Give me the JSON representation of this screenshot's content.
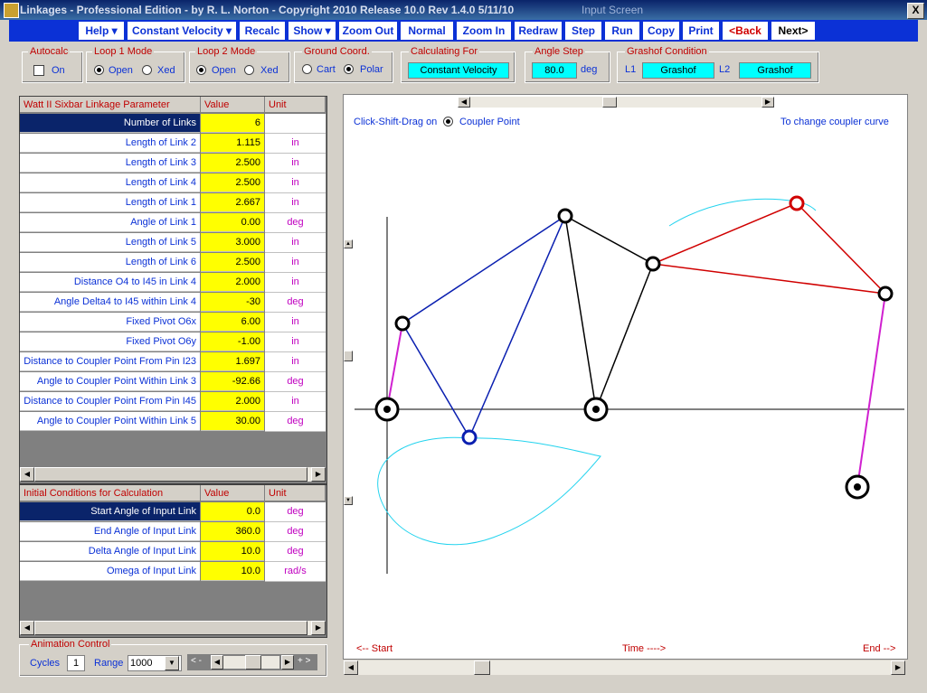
{
  "window": {
    "title": "Linkages - Professional Edition - by R. L. Norton - Copyright 2010   Release 10.0   Rev 1.4.0   5/11/10",
    "screen_name": "Input Screen",
    "close_glyph": "X"
  },
  "toolbar": {
    "items": [
      "Help ▾",
      "Constant Velocity ▾",
      "Recalc",
      "Show ▾",
      "Zoom Out",
      "Normal",
      "Zoom In",
      "Redraw",
      "Step",
      "Run",
      "Copy",
      "Print",
      "<Back",
      "Next>"
    ]
  },
  "settings": {
    "autocalc": {
      "title": "Autocalc",
      "option": "On"
    },
    "loop1": {
      "title": "Loop 1 Mode",
      "options": [
        "Open",
        "Xed"
      ]
    },
    "loop2": {
      "title": "Loop 2 Mode",
      "options": [
        "Open",
        "Xed"
      ]
    },
    "ground": {
      "title": "Ground Coord.",
      "options": [
        "Cart",
        "Polar"
      ]
    },
    "calculating": {
      "title": "Calculating For",
      "value": "Constant Velocity"
    },
    "angle_step": {
      "title": "Angle Step",
      "value": "80.0",
      "unit": "deg"
    },
    "grashof": {
      "title": "Grashof Condition",
      "l1_label": "L1",
      "l1_value": "Grashof",
      "l2_label": "L2",
      "l2_value": "Grashof"
    }
  },
  "params_table": {
    "headers": [
      "Watt II Sixbar Linkage Parameter",
      "Value",
      "Unit"
    ],
    "rows": [
      {
        "name": "Number of Links",
        "value": "6",
        "unit": ""
      },
      {
        "name": "Length of Link 2",
        "value": "1.115",
        "unit": "in"
      },
      {
        "name": "Length of Link 3",
        "value": "2.500",
        "unit": "in"
      },
      {
        "name": "Length of Link 4",
        "value": "2.500",
        "unit": "in"
      },
      {
        "name": "Length of Link 1",
        "value": "2.667",
        "unit": "in"
      },
      {
        "name": "Angle of Link 1",
        "value": "0.00",
        "unit": "deg"
      },
      {
        "name": "Length of Link 5",
        "value": "3.000",
        "unit": "in"
      },
      {
        "name": "Length of Link 6",
        "value": "2.500",
        "unit": "in"
      },
      {
        "name": "Distance O4 to I45 in Link 4",
        "value": "2.000",
        "unit": "in"
      },
      {
        "name": "Angle Delta4 to I45 within Link 4",
        "value": "-30",
        "unit": "deg"
      },
      {
        "name": "Fixed Pivot O6x",
        "value": "6.00",
        "unit": "in"
      },
      {
        "name": "Fixed Pivot O6y",
        "value": "-1.00",
        "unit": "in"
      },
      {
        "name": "Distance to Coupler Point From Pin I23",
        "value": "1.697",
        "unit": "in"
      },
      {
        "name": "Angle to Coupler Point Within Link 3",
        "value": "-92.66",
        "unit": "deg"
      },
      {
        "name": "Distance to Coupler Point From Pin I45",
        "value": "2.000",
        "unit": "in"
      },
      {
        "name": "Angle to Coupler Point Within Link 5",
        "value": "30.00",
        "unit": "deg"
      }
    ]
  },
  "initial_table": {
    "headers": [
      "Initial Conditions for Calculation",
      "Value",
      "Unit"
    ],
    "rows": [
      {
        "name": "Start Angle of Input Link",
        "value": "0.0",
        "unit": "deg"
      },
      {
        "name": "End Angle of Input Link",
        "value": "360.0",
        "unit": "deg"
      },
      {
        "name": "Delta Angle of Input Link",
        "value": "10.0",
        "unit": "deg"
      },
      {
        "name": "Omega of Input Link",
        "value": "10.0",
        "unit": "rad/s"
      }
    ]
  },
  "animation": {
    "title": "Animation Control",
    "cycles_label": "Cycles",
    "cycles_value": "1",
    "range_label": "Range",
    "range_value": "1000",
    "slow_label": "< -",
    "fast_label": "+ >"
  },
  "plot": {
    "drag_label": "Click-Shift-Drag on",
    "drag_option": "Coupler Point",
    "hint": "To change coupler curve",
    "start_label": "<-- Start",
    "time_label": "Time ---->",
    "end_label": "End -->"
  },
  "colors": {
    "toolbar_bg": "#0b31d6",
    "link_blue": "#0a1fb0",
    "link_red": "#d00000",
    "link_magenta": "#d020d0",
    "coupler_curve": "#22d3ee"
  }
}
